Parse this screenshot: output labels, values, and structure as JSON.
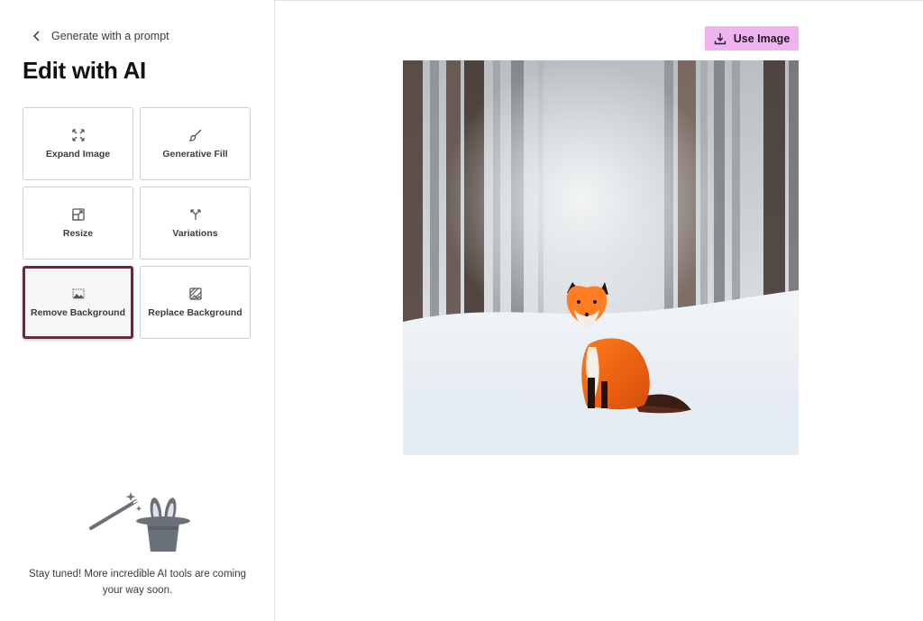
{
  "sidebar": {
    "back_label": "Generate with a prompt",
    "title": "Edit with AI",
    "tools": [
      {
        "label": "Expand Image",
        "icon": "expand-icon"
      },
      {
        "label": "Generative Fill",
        "icon": "brush-icon"
      },
      {
        "label": "Resize",
        "icon": "resize-icon"
      },
      {
        "label": "Variations",
        "icon": "variations-icon"
      },
      {
        "label": "Remove Background",
        "icon": "remove-background-icon",
        "selected": true
      },
      {
        "label": "Replace Background",
        "icon": "replace-background-icon"
      }
    ],
    "coming_soon": "Stay tuned! More incredible AI tools are coming your way soon."
  },
  "main": {
    "use_image_label": "Use Image",
    "use_image_icon": "download-icon"
  },
  "colors": {
    "accent_button": "#f0b3f1",
    "selected_border": "#7a1f3d"
  }
}
